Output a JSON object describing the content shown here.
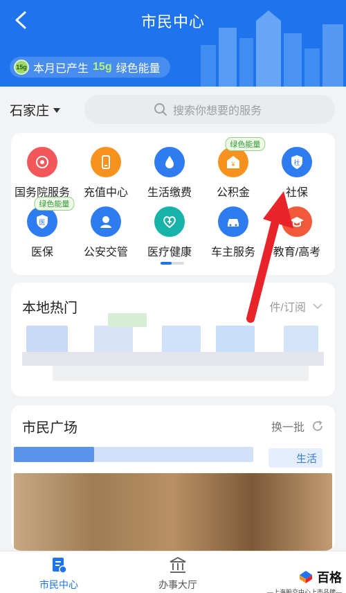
{
  "header": {
    "title": "市民中心",
    "energy_prefix": "本月已产生",
    "energy_value": "15g",
    "energy_suffix": "绿色能量",
    "energy_badge": "15g"
  },
  "location": {
    "city": "石家庄"
  },
  "search": {
    "placeholder": "搜索你想要的服务"
  },
  "services": {
    "row1": [
      {
        "label": "国务院服务",
        "icon": "state-council-icon",
        "color": "#f2575a"
      },
      {
        "label": "充值中心",
        "icon": "phone-recharge-icon",
        "color": "#f7921e"
      },
      {
        "label": "生活缴费",
        "icon": "water-drop-icon",
        "color": "#2f7cf0"
      },
      {
        "label": "公积金",
        "icon": "housing-fund-icon",
        "color": "#f7921e",
        "tag": "绿色能量"
      },
      {
        "label": "社保",
        "icon": "social-security-icon",
        "color": "#2f7cf0"
      }
    ],
    "row2": [
      {
        "label": "医保",
        "icon": "medical-insurance-icon",
        "color": "#2f7cf0",
        "tag": "绿色能量"
      },
      {
        "label": "公安交管",
        "icon": "police-icon",
        "color": "#2f7cf0"
      },
      {
        "label": "医疗健康",
        "icon": "health-icon",
        "color": "#17b3a8"
      },
      {
        "label": "车主服务",
        "icon": "car-icon",
        "color": "#2f7cf0"
      },
      {
        "label": "教育/高考",
        "icon": "graduation-icon",
        "color": "#f05a3a"
      }
    ]
  },
  "hot": {
    "title": "本地热门",
    "subscribe": "件/订阅"
  },
  "plaza": {
    "title": "市民广场",
    "refresh": "换一批",
    "tag": "生活"
  },
  "nav": [
    {
      "label": "市民中心",
      "icon": "citizen-center-icon",
      "active": true
    },
    {
      "label": "办事大厅",
      "icon": "hall-icon",
      "active": false
    }
  ],
  "watermark": {
    "name": "百格",
    "sub": "—上海股交中心上市品牌—"
  },
  "colors": {
    "primary": "#1f73ec",
    "accent_red": "#e8242a"
  }
}
